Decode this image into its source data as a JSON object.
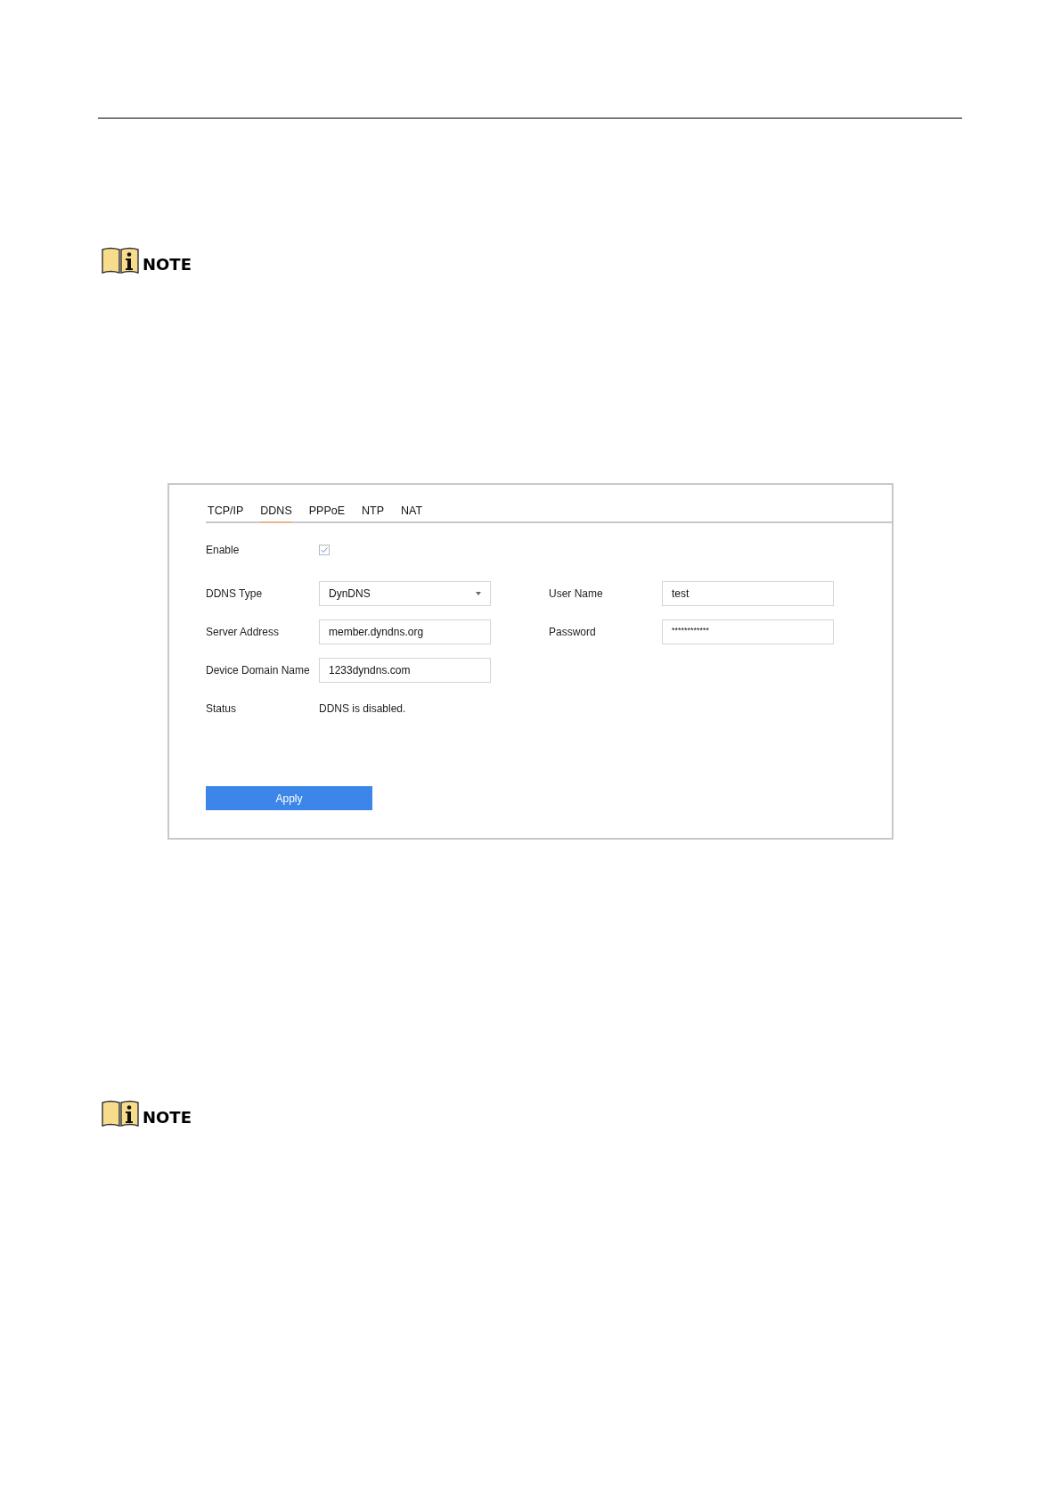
{
  "notes": [
    "NOTE",
    "NOTE"
  ],
  "dialog": {
    "tabs": [
      {
        "label": "TCP/IP",
        "selected": false
      },
      {
        "label": "DDNS",
        "selected": true
      },
      {
        "label": "PPPoE",
        "selected": false
      },
      {
        "label": "NTP",
        "selected": false
      },
      {
        "label": "NAT",
        "selected": false
      }
    ],
    "enable": {
      "label": "Enable",
      "checked": true
    },
    "rows": [
      {
        "left": {
          "label": "DDNS Type",
          "value": "DynDNS",
          "kind": "dropdown"
        },
        "right": {
          "label": "User Name",
          "value": "test",
          "kind": "text"
        }
      },
      {
        "left": {
          "label": "Server Address",
          "value": "member.dyndns.org",
          "kind": "text"
        },
        "right": {
          "label": "Password",
          "value": "************",
          "kind": "password"
        }
      },
      {
        "left": {
          "label": "Device Domain Name",
          "value": "1233dyndns.com",
          "kind": "text"
        }
      }
    ],
    "status": {
      "label": "Status",
      "value": "DDNS is disabled."
    },
    "apply": "Apply"
  }
}
